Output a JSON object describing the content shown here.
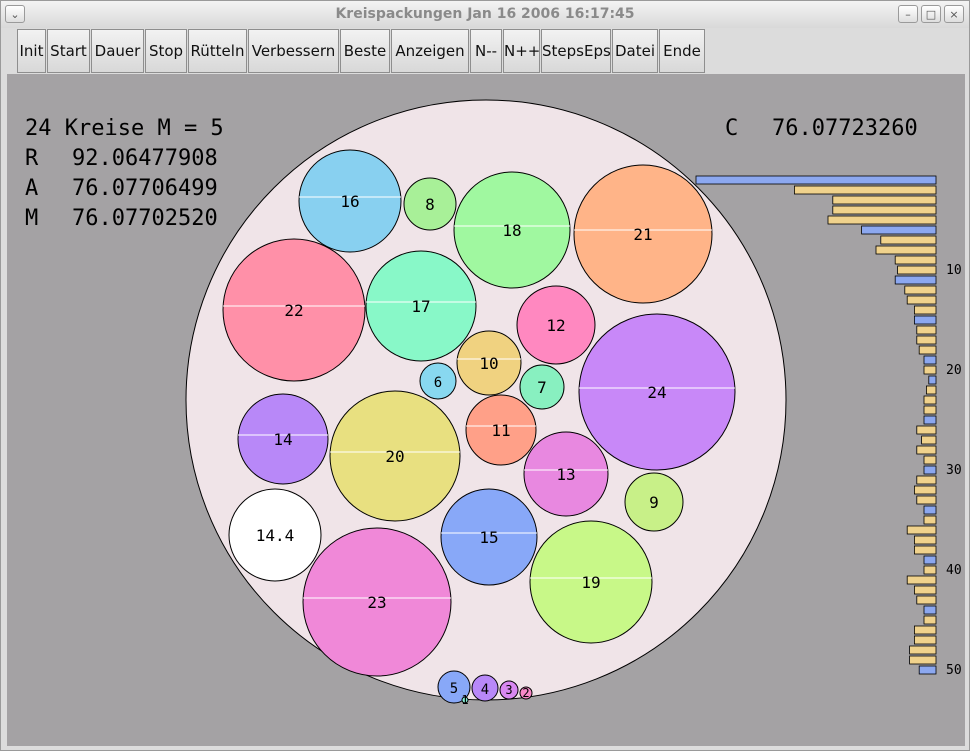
{
  "window": {
    "title": "Kreispackungen Jan 16 2006  16:17:45",
    "menu_icon": "chevron-down-icon",
    "minimize_icon": "minimize-icon",
    "maximize_icon": "maximize-icon",
    "close_icon": "close-icon"
  },
  "toolbar": {
    "buttons": [
      "Init",
      "Start",
      "Dauer",
      "Stop",
      "Rütteln",
      "Verbessern",
      "Beste",
      "Anzeigen",
      "N--",
      "N++",
      "StepsEps",
      "Datei",
      "Ende"
    ]
  },
  "stats": {
    "line1": "24 Kreise M = 5",
    "r_label": "R",
    "r_value": "92.06477908",
    "a_label": "A",
    "a_value": "76.07706499",
    "m_label": "M",
    "m_value": "76.07702520",
    "c_label": "C",
    "c_value": "76.07723260"
  },
  "colors": {
    "background": "#a4a2a4",
    "container": "#f0e4e8",
    "bar_normal": "#f0d28c",
    "bar_marked": "#8ca8f0"
  },
  "circles": [
    {
      "label": "16",
      "color": "#88d0f0"
    },
    {
      "label": "8",
      "color": "#a8f098"
    },
    {
      "label": "18",
      "color": "#a0f8a0"
    },
    {
      "label": "21",
      "color": "#ffb488"
    },
    {
      "label": "22",
      "color": "#ff90a8"
    },
    {
      "label": "17",
      "color": "#88f8c8"
    },
    {
      "label": "12",
      "color": "#ff88c0"
    },
    {
      "label": "10",
      "color": "#f0d280"
    },
    {
      "label": "6",
      "color": "#88d8f0"
    },
    {
      "label": "7",
      "color": "#88f0c0"
    },
    {
      "label": "24",
      "color": "#c888f8"
    },
    {
      "label": "14",
      "color": "#b888f8"
    },
    {
      "label": "20",
      "color": "#e8e080"
    },
    {
      "label": "11",
      "color": "#ffa088"
    },
    {
      "label": "13",
      "color": "#e888e0"
    },
    {
      "label": "9",
      "color": "#c8f088"
    },
    {
      "label": "14.4",
      "color": "#ffffff"
    },
    {
      "label": "15",
      "color": "#88a8f8"
    },
    {
      "label": "19",
      "color": "#c8f888"
    },
    {
      "label": "23",
      "color": "#f088d8"
    },
    {
      "label": "5",
      "color": "#88a8f8"
    },
    {
      "label": "4",
      "color": "#b888f8"
    },
    {
      "label": "3",
      "color": "#d888f0"
    },
    {
      "label": "2",
      "color": "#f888c8"
    },
    {
      "label": "1",
      "color": "#88f0d8"
    }
  ],
  "histogram": {
    "tick_labels": [
      "10",
      "20",
      "30",
      "40",
      "50"
    ],
    "bars": [
      {
        "v": 1.0,
        "m": true
      },
      {
        "v": 0.59,
        "m": false
      },
      {
        "v": 0.43,
        "m": false
      },
      {
        "v": 0.43,
        "m": false
      },
      {
        "v": 0.45,
        "m": false
      },
      {
        "v": 0.31,
        "m": true
      },
      {
        "v": 0.23,
        "m": false
      },
      {
        "v": 0.25,
        "m": false
      },
      {
        "v": 0.17,
        "m": false
      },
      {
        "v": 0.16,
        "m": false
      },
      {
        "v": 0.17,
        "m": true
      },
      {
        "v": 0.13,
        "m": false
      },
      {
        "v": 0.12,
        "m": false
      },
      {
        "v": 0.09,
        "m": false
      },
      {
        "v": 0.09,
        "m": true
      },
      {
        "v": 0.08,
        "m": false
      },
      {
        "v": 0.08,
        "m": false
      },
      {
        "v": 0.07,
        "m": false
      },
      {
        "v": 0.05,
        "m": true
      },
      {
        "v": 0.05,
        "m": false
      },
      {
        "v": 0.03,
        "m": true
      },
      {
        "v": 0.04,
        "m": false
      },
      {
        "v": 0.05,
        "m": false
      },
      {
        "v": 0.05,
        "m": false
      },
      {
        "v": 0.05,
        "m": true
      },
      {
        "v": 0.08,
        "m": false
      },
      {
        "v": 0.06,
        "m": false
      },
      {
        "v": 0.08,
        "m": false
      },
      {
        "v": 0.05,
        "m": false
      },
      {
        "v": 0.05,
        "m": true
      },
      {
        "v": 0.08,
        "m": false
      },
      {
        "v": 0.09,
        "m": false
      },
      {
        "v": 0.08,
        "m": false
      },
      {
        "v": 0.05,
        "m": true
      },
      {
        "v": 0.05,
        "m": false
      },
      {
        "v": 0.12,
        "m": false
      },
      {
        "v": 0.09,
        "m": false
      },
      {
        "v": 0.09,
        "m": false
      },
      {
        "v": 0.05,
        "m": true
      },
      {
        "v": 0.05,
        "m": false
      },
      {
        "v": 0.12,
        "m": false
      },
      {
        "v": 0.09,
        "m": false
      },
      {
        "v": 0.08,
        "m": false
      },
      {
        "v": 0.05,
        "m": true
      },
      {
        "v": 0.05,
        "m": false
      },
      {
        "v": 0.09,
        "m": false
      },
      {
        "v": 0.09,
        "m": false
      },
      {
        "v": 0.11,
        "m": false
      },
      {
        "v": 0.11,
        "m": false
      },
      {
        "v": 0.07,
        "m": true
      }
    ]
  }
}
